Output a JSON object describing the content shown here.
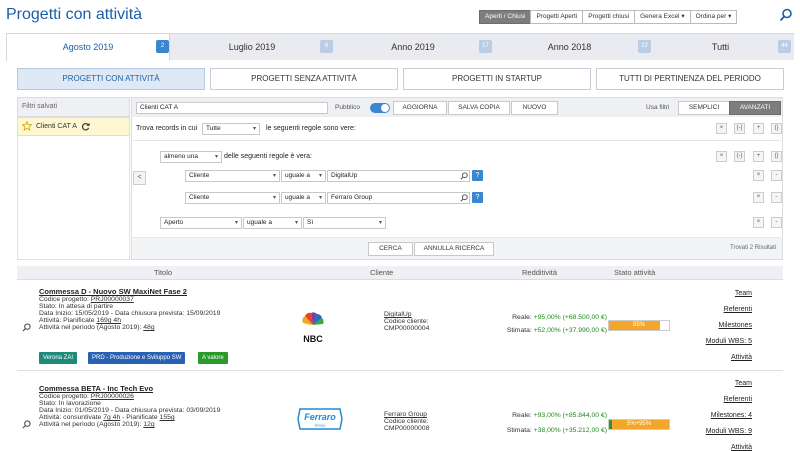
{
  "header": {
    "title": "Progetti con attività",
    "buttons": [
      "Aperti / Chiusi",
      "Progetti Aperti",
      "Progetti chiusi",
      "Genera Excel",
      "Ordina per"
    ]
  },
  "period_tabs": [
    {
      "label": "Agosto 2019",
      "badge": "2",
      "active": true
    },
    {
      "label": "Luglio 2019",
      "badge": "6"
    },
    {
      "label": "Anno 2019",
      "badge": "17"
    },
    {
      "label": "Anno 2018",
      "badge": "22"
    },
    {
      "label": "Tutti",
      "badge": "44"
    }
  ],
  "project_tabs": [
    "PROGETTI CON ATTIVITÀ",
    "PROGETTI SENZA ATTIVITÀ",
    "PROGETTI IN STARTUP",
    "TUTTI DI PERTINENZA DEL PERIODO"
  ],
  "saved_filters": {
    "heading": "Filtri salvati",
    "items": [
      "Clienti CAT A"
    ]
  },
  "filter_panel": {
    "name_value": "Clienti CAT A",
    "public_label": "Pubblico",
    "btn_update": "AGGIORNA",
    "btn_save_copy": "SALVA COPIA",
    "btn_new": "NUOVO",
    "use_filters_label": "Usa filtri",
    "btn_simple": "SEMPLICI",
    "btn_advanced": "AVANZATI",
    "find_records_label": "Trova records in cui",
    "find_records_select": "Tutte",
    "rules_label": "le seguenti regole sono vere:",
    "group_select": "almeno una",
    "group_rules_label": "delle seguenti regole è vera:",
    "rules": [
      {
        "field": "Cliente",
        "op": "uguale a",
        "value": "DigitalUp"
      },
      {
        "field": "Cliente",
        "op": "uguale a",
        "value": "Ferraro Group"
      }
    ],
    "rule3": {
      "field": "Aperto",
      "op": "uguale a",
      "value": "Sì"
    },
    "group_ctrls": [
      "×",
      "(-)",
      "+",
      "()"
    ],
    "row_ctrls": [
      "×",
      "-"
    ],
    "btn_search": "CERCA",
    "btn_cancel_search": "ANNULLA RICERCA",
    "found": "Trovati 2 Risultati"
  },
  "table": {
    "headers": [
      "Titolo",
      "Cliente",
      "Redditività",
      "Stato attività"
    ],
    "rows": [
      {
        "title": "Commessa D - Nuovo SW MaxiNet Fase 2",
        "code_label": "Codice progetto: ",
        "code": "PRJ00000037",
        "state": "Stato: In attesa di partire",
        "dates": "Data Inizio: 15/05/2019 - Data chiusura prevista: 15/09/2019",
        "activity_prefix": "Attività: Pianificate ",
        "activity_link": "169g 4h",
        "period_prefix": "Attività nel periodo (Agosto 2019): ",
        "period_link": "48g",
        "tags": [
          {
            "label": "Verona ZAI",
            "color": "#1e8a7a"
          },
          {
            "label": "PRD - Produzione e Sviluppo SW",
            "color": "#2a62b3"
          },
          {
            "label": "A valore",
            "color": "#2a9b2a"
          }
        ],
        "logo": "NBC",
        "client_name": "DigitalUp",
        "client_code_label": "Codice cliente:",
        "client_code": "CMP00000004",
        "real_label": "Reale:",
        "real_value": "+95,00% (+68.500,00 €)",
        "est_label": "Stimata:",
        "est_value": "+52,00% (+37.990,00 €)",
        "progress_text": "85%",
        "progress": 0.85,
        "links": [
          "Team",
          "Referenti",
          "Milestones",
          "Moduli WBS: 5",
          "Attività"
        ]
      },
      {
        "title": "Commessa BETA - Inc Tech Evo",
        "code_label": "Codice progetto: ",
        "code": "PRJ00000026",
        "state": "Stato: In lavorazione",
        "dates": "Data Inizio: 01/05/2019 - Data chiusura prevista: 03/09/2019",
        "activity_prefix": "Attività: consuntivate ",
        "activity_link": "7g 4h",
        "activity_mid": " - Pianificate ",
        "activity_link2": "155g",
        "period_prefix": "Attività nel periodo (Agosto 2019): ",
        "period_link": "12g",
        "logo": "Ferraro",
        "logo_sub": "Group",
        "client_name": "Ferraro Group",
        "client_code_label": "Codice cliente:",
        "client_code": "CMP00000008",
        "real_label": "Reale:",
        "real_value": "+93,00% (+85.844,00 €)",
        "est_label": "Stimata:",
        "est_value": "+38,00% (+35.212,00 €)",
        "progress_text": "5%+95%",
        "progress": 0.05,
        "links": [
          "Team",
          "Referenti",
          "Milestones: 4",
          "Moduli WBS: 9",
          "Attività"
        ]
      }
    ]
  },
  "colors": {
    "accent": "#3a86d1",
    "title": "#1a5fa8",
    "positive": "#1f8a1f",
    "progress": "#f4a62a"
  }
}
